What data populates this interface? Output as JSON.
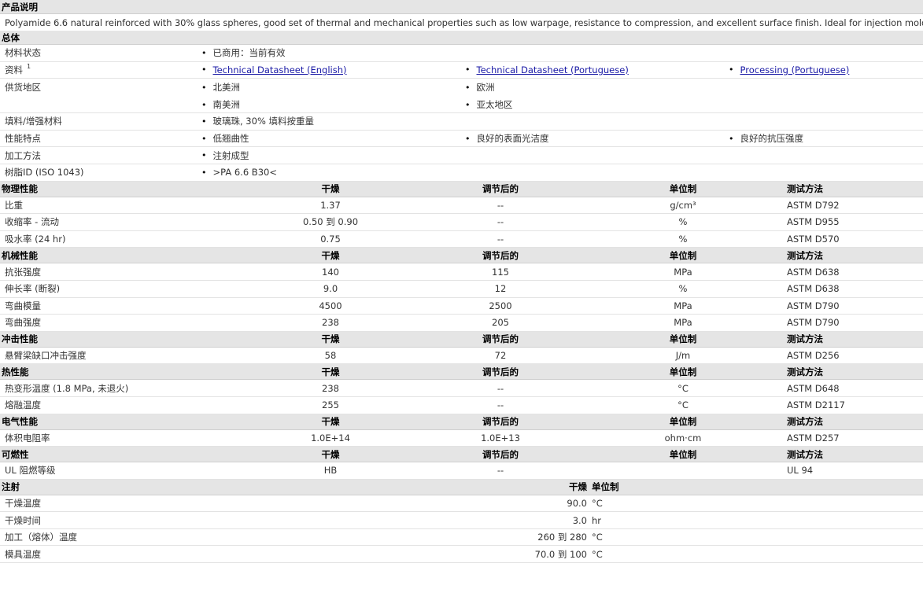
{
  "description": {
    "header": "产品说明",
    "text": "Polyamide 6.6 natural reinforced with 30% glass spheres, good set of thermal and mechanical properties such as low warpage, resistance to compression, and excellent surface finish. Ideal for injection molding."
  },
  "general": {
    "header": "总体",
    "rows": [
      {
        "label": "材料状态",
        "items": [
          "已商用：当前有效"
        ]
      },
      {
        "label": "资料",
        "sup": "1",
        "links": [
          "Technical Datasheet (English)",
          "Technical Datasheet (Portuguese)",
          "Processing (Portuguese)"
        ]
      },
      {
        "label": "供货地区",
        "items": [
          "北美洲",
          "欧洲",
          "南美洲",
          "亚太地区"
        ]
      },
      {
        "label": "填料/增强材料",
        "items": [
          "玻璃珠, 30% 填料按重量"
        ]
      },
      {
        "label": "性能特点",
        "items": [
          "低翘曲性",
          "良好的表面光洁度",
          "良好的抗压强度"
        ]
      },
      {
        "label": "加工方法",
        "items": [
          "注射成型"
        ]
      },
      {
        "label": "树脂ID (ISO 1043)",
        "items": [
          ">PA 6.6 B30<"
        ]
      }
    ]
  },
  "column_headers": {
    "dry": "干燥",
    "conditioned": "调节后的",
    "unit": "单位制",
    "method": "测试方法"
  },
  "sections": [
    {
      "title": "物理性能",
      "rows": [
        {
          "name": "比重",
          "dry": "1.37",
          "cond": "--",
          "unit": "g/cm³",
          "method": "ASTM D792"
        },
        {
          "name": "收缩率  - 流动",
          "dry": "0.50 到  0.90",
          "cond": "--",
          "unit": "%",
          "method": "ASTM D955"
        },
        {
          "name": "吸水率  (24 hr)",
          "dry": "0.75",
          "cond": "--",
          "unit": "%",
          "method": "ASTM D570"
        }
      ]
    },
    {
      "title": "机械性能",
      "rows": [
        {
          "name": "抗张强度",
          "dry": "140",
          "cond": "115",
          "unit": "MPa",
          "method": "ASTM D638"
        },
        {
          "name": "伸长率  (断裂)",
          "dry": "9.0",
          "cond": "12",
          "unit": "%",
          "method": "ASTM D638"
        },
        {
          "name": "弯曲模量",
          "dry": "4500",
          "cond": "2500",
          "unit": "MPa",
          "method": "ASTM D790"
        },
        {
          "name": "弯曲强度",
          "dry": "238",
          "cond": "205",
          "unit": "MPa",
          "method": "ASTM D790"
        }
      ]
    },
    {
      "title": "冲击性能",
      "rows": [
        {
          "name": "悬臂梁缺口冲击强度",
          "dry": "58",
          "cond": "72",
          "unit": "J/m",
          "method": "ASTM D256"
        }
      ]
    },
    {
      "title": "热性能",
      "rows": [
        {
          "name": "热变形温度  (1.8 MPa, 未退火)",
          "dry": "238",
          "cond": "--",
          "unit": "°C",
          "method": "ASTM D648"
        },
        {
          "name": "熔融温度",
          "dry": "255",
          "cond": "--",
          "unit": "°C",
          "method": "ASTM D2117"
        }
      ]
    },
    {
      "title": "电气性能",
      "rows": [
        {
          "name": "体积电阻率",
          "dry": "1.0E+14",
          "cond": "1.0E+13",
          "unit": "ohm·cm",
          "method": "ASTM D257"
        }
      ]
    },
    {
      "title": "可燃性",
      "rows": [
        {
          "name": "UL 阻燃等级",
          "dry": "HB",
          "cond": "--",
          "unit": "",
          "method": "UL 94"
        }
      ]
    }
  ],
  "injection": {
    "title": "注射",
    "dry_header": "干燥",
    "unit_header": "单位制",
    "rows": [
      {
        "name": "干燥温度",
        "value": "90.0",
        "unit": "°C"
      },
      {
        "name": "干燥时间",
        "value": "3.0",
        "unit": "hr"
      },
      {
        "name": "加工（熔体）温度",
        "value": "260 到  280",
        "unit": "°C"
      },
      {
        "name": "模具温度",
        "value": "70.0 到  100",
        "unit": "°C"
      }
    ]
  }
}
